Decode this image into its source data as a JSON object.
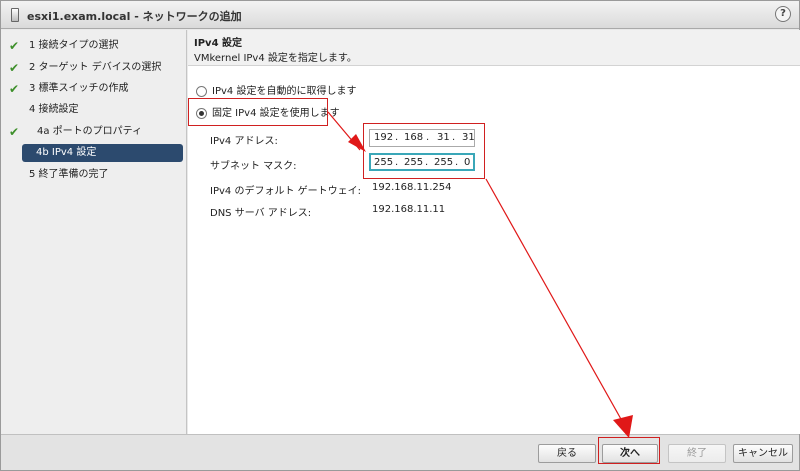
{
  "window": {
    "title": "esxi1.exam.local - ネットワークの追加",
    "help_glyph": "?",
    "host_icon": "server-host-icon"
  },
  "sidebar": {
    "steps": [
      {
        "label": "1 接続タイプの選択",
        "done": true
      },
      {
        "label": "2 ターゲット デバイスの選択",
        "done": true
      },
      {
        "label": "3 標準スイッチの作成",
        "done": true
      },
      {
        "label": "4 接続設定",
        "done": false
      },
      {
        "label": "4a ポートのプロパティ",
        "done": true
      },
      {
        "label": "4b IPv4 設定",
        "done": false,
        "active": true
      },
      {
        "label": "5 終了準備の完了",
        "done": false
      }
    ],
    "check_glyph": "✔"
  },
  "content": {
    "title": "IPv4 設定",
    "subtitle": "VMkernel IPv4 設定を指定します。",
    "radio_auto": "IPv4 設定を自動的に取得します",
    "radio_static": "固定 IPv4 設定を使用します",
    "fields": {
      "ip_label": "IPv4 アドレス:",
      "ip_octets": [
        "192",
        "168",
        "31",
        "31"
      ],
      "mask_label": "サブネット マスク:",
      "mask_octets": [
        "255",
        "255",
        "255",
        "0"
      ],
      "gateway_label": "IPv4 のデフォルト ゲートウェイ:",
      "gateway_value": "192.168.11.254",
      "dns_label": "DNS サーバ アドレス:",
      "dns_value": "192.168.11.11"
    },
    "dot": "."
  },
  "footer": {
    "back": "戻る",
    "next": "次へ",
    "finish": "終了",
    "cancel": "キャンセル"
  },
  "colors": {
    "accent": "#2c4a6e",
    "annotation_red": "#d02020",
    "focus_teal": "#3aa7b8",
    "check_green": "#3d8f2a"
  }
}
